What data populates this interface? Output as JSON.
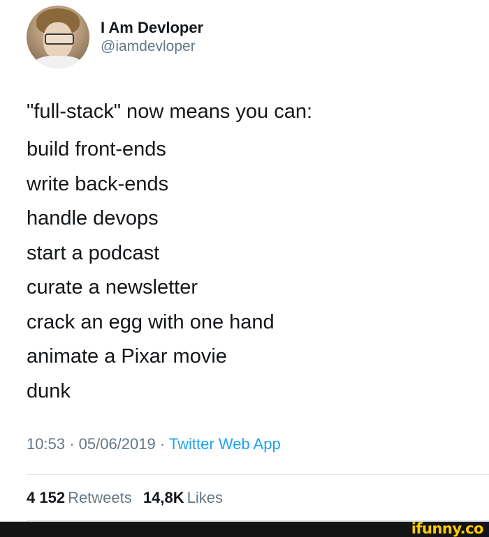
{
  "tweet": {
    "display_name": "I Am Devloper",
    "handle": "@iamdevloper",
    "intro": "\"full-stack\" now means you can:",
    "lines": [
      "build front-ends",
      "write back-ends",
      "handle devops",
      "start a podcast",
      "curate a newsletter",
      "crack an egg with one hand",
      "animate a Pixar movie",
      "dunk"
    ],
    "time": "10:53",
    "date": "05/06/2019",
    "separator": "·",
    "source": "Twitter Web App",
    "retweets_count": "4 152",
    "retweets_label": "Retweets",
    "likes_count": "14,8K",
    "likes_label": "Likes"
  },
  "watermark": {
    "text": "ifunny.co",
    "color": "#ffcc00"
  },
  "colors": {
    "text": "#14171a",
    "secondary": "#657786",
    "link": "#1da1f2"
  }
}
